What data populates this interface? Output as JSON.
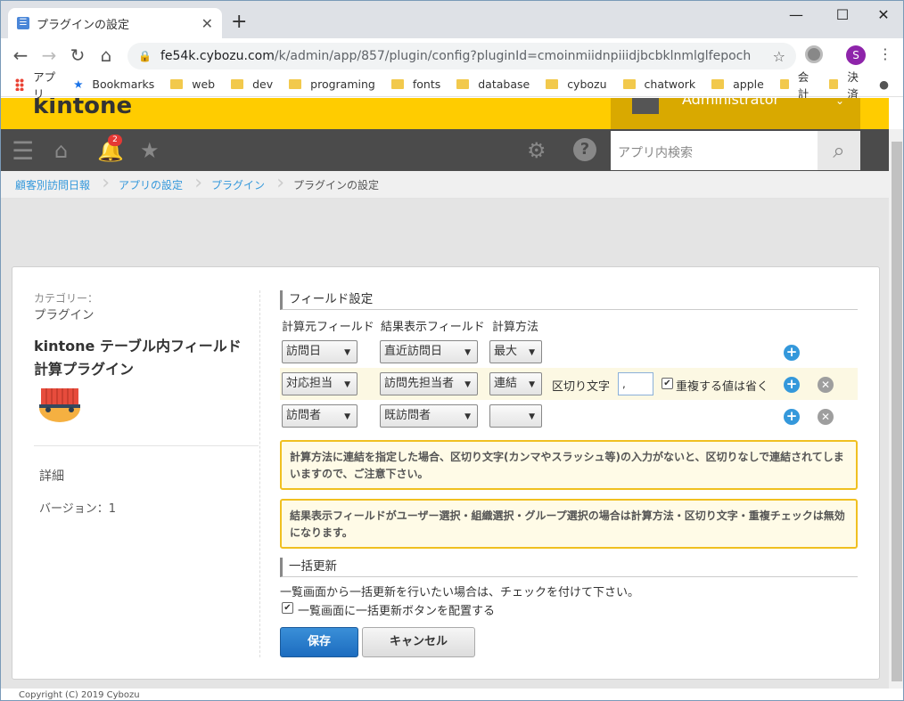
{
  "browser": {
    "tab_title": "プラグインの設定",
    "url_host": "fe54k.cybozu.com",
    "url_path": "/k/admin/app/857/plugin/config?pluginId=cmoinmiidnpiiidjbcbklnmlglfepoch",
    "avatar_letter": "S",
    "bookmarks": [
      "アプリ",
      "Bookmarks",
      "web",
      "dev",
      "programing",
      "fonts",
      "database",
      "cybozu",
      "chatwork",
      "apple",
      "会計",
      "決済"
    ]
  },
  "kintone": {
    "logo": "kintone",
    "user": "Administrator",
    "notification_count": "2",
    "search_placeholder": "アプリ内検索"
  },
  "breadcrumb": [
    "顧客別訪問日報",
    "アプリの設定",
    "プラグイン",
    "プラグインの設定"
  ],
  "sidebar": {
    "category_label": "カテゴリー：",
    "category_value": "プラグイン",
    "plugin_title_1": "kintone テーブル内フィールド",
    "plugin_title_2": "計算プラグイン",
    "details": "詳細",
    "version": "バージョン：1"
  },
  "field_settings": {
    "heading": "フィールド設定",
    "col_source": "計算元フィールド",
    "col_result": "結果表示フィールド",
    "col_method": "計算方法",
    "rows": [
      {
        "source": "訪問日",
        "result": "直近訪問日",
        "method": "最大"
      },
      {
        "source": "対応担当",
        "result": "訪問先担当者",
        "method": "連結",
        "delimiter_label": "区切り文字",
        "delimiter_value": ",",
        "dedupe_label": "重複する値は省く",
        "dedupe_checked": true
      },
      {
        "source": "訪問者",
        "result": "既訪問者",
        "method": ""
      }
    ]
  },
  "notes": {
    "note1": "計算方法に連結を指定した場合、区切り文字(カンマやスラッシュ等)の入力がないと、区切りなしで連結されてしまいますので、ご注意下さい。",
    "note2": "結果表示フィールドがユーザー選択・組織選択・グループ選択の場合は計算方法・区切り文字・重複チェックは無効になります。"
  },
  "bulk_update": {
    "heading": "一括更新",
    "description": "一覧画面から一括更新を行いたい場合は、チェックを付けて下さい。",
    "checkbox_label": "一覧画面に一括更新ボタンを配置する",
    "checked": true
  },
  "buttons": {
    "save": "保存",
    "cancel": "キャンセル"
  },
  "footer": "Copyright (C) 2019 Cybozu"
}
